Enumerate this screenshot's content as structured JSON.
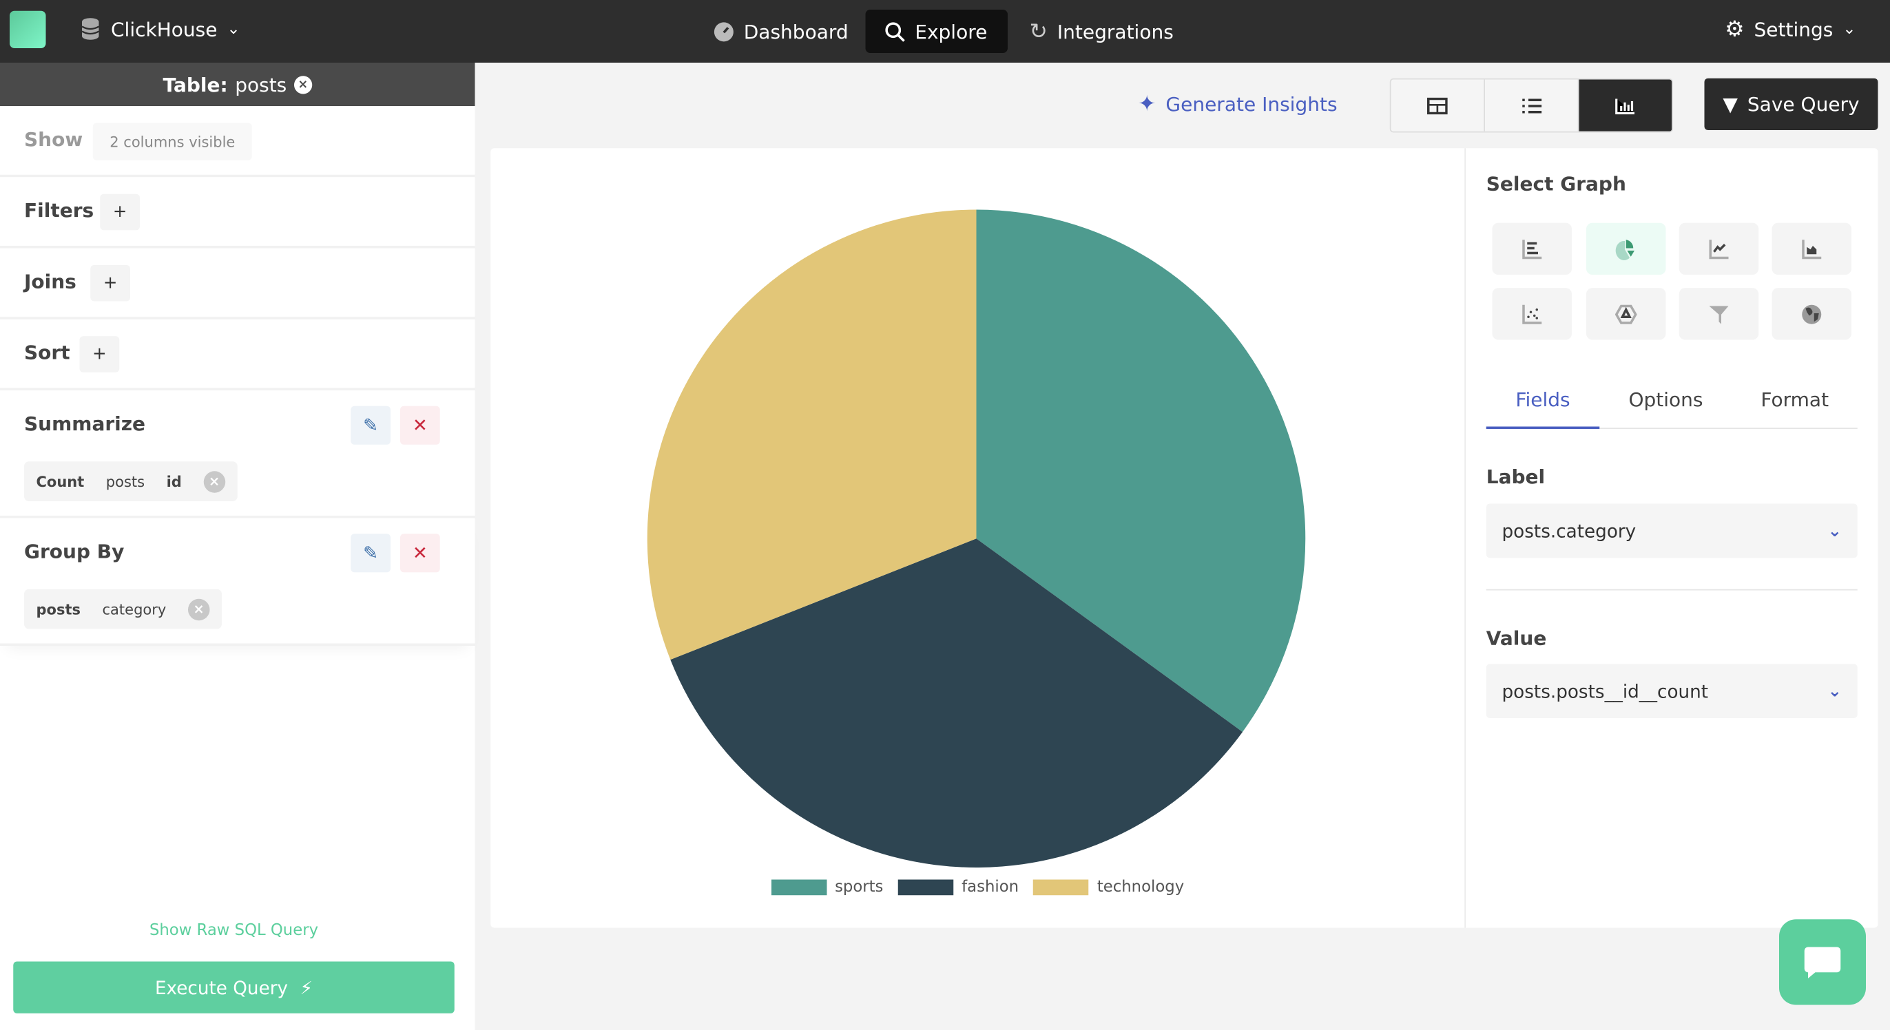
{
  "topbar": {
    "datasource": "ClickHouse",
    "nav": [
      {
        "label": "Dashboard",
        "icon": "gauge-icon"
      },
      {
        "label": "Explore",
        "icon": "search-icon",
        "active": true
      },
      {
        "label": "Integrations",
        "icon": "refresh-icon"
      }
    ],
    "settings": "Settings"
  },
  "sidebar": {
    "table_label": "Table:",
    "table_name": "posts",
    "show": {
      "title": "Show",
      "value": "2 columns visible"
    },
    "filters": {
      "title": "Filters",
      "add": "+"
    },
    "joins": {
      "title": "Joins",
      "add": "+"
    },
    "sort": {
      "title": "Sort",
      "add": "+"
    },
    "summarize": {
      "title": "Summarize",
      "chip": {
        "agg": "Count",
        "table": "posts",
        "column": "id"
      }
    },
    "group_by": {
      "title": "Group By",
      "chip": {
        "table": "posts",
        "column": "category"
      }
    },
    "raw_sql": "Show Raw SQL Query",
    "execute": "Execute Query"
  },
  "toolbar": {
    "insights": "Generate Insights",
    "views": [
      "table-view",
      "list-view",
      "chart-view"
    ],
    "active_view": "chart-view",
    "save": "Save Query"
  },
  "panel": {
    "select_graph": "Select Graph",
    "graph_types": [
      "bar",
      "pie",
      "line",
      "area",
      "scatter",
      "radar",
      "funnel",
      "map"
    ],
    "active_graph": "pie",
    "tabs": [
      "Fields",
      "Options",
      "Format"
    ],
    "active_tab": "Fields",
    "label_title": "Label",
    "label_value": "posts.category",
    "value_title": "Value",
    "value_value": "posts.posts__id__count"
  },
  "colors": {
    "accent": "#5ccf9d",
    "link": "#4a5fc1",
    "sports": "#4e9b8f",
    "fashion": "#2e4552",
    "technology": "#e2c678"
  },
  "chart_data": {
    "type": "pie",
    "categories": [
      "sports",
      "fashion",
      "technology"
    ],
    "values": [
      35,
      34,
      31
    ],
    "legend": "bottom"
  }
}
